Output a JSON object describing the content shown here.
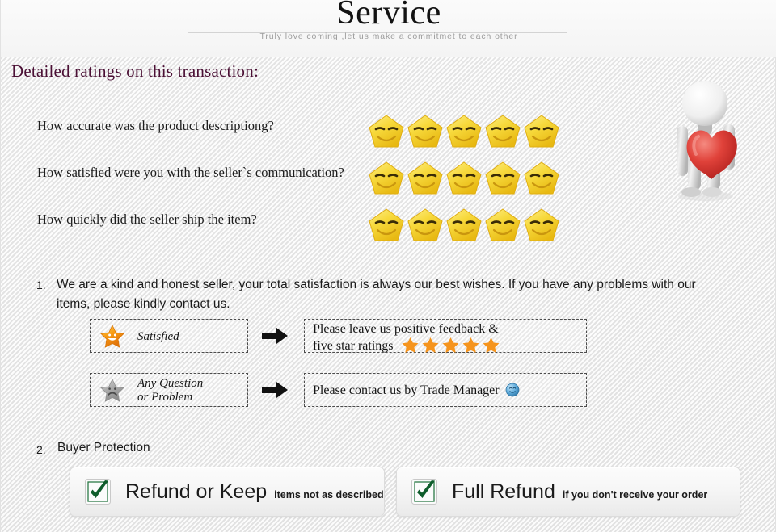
{
  "header": {
    "title": "Service",
    "subtitle": "Truly love coming ,let us make a commitmet to each other"
  },
  "section": {
    "heading": "Detailed ratings on this transaction:"
  },
  "ratings": {
    "stars_per_row": 5,
    "star_icon": "smiley-star-icon",
    "rows": [
      {
        "question": "How accurate was the product descriptiong?",
        "stars": 5
      },
      {
        "question": "How satisfied were you with the seller`s communication?",
        "stars": 5
      },
      {
        "question": "How quickly did the seller ship the item?",
        "stars": 5
      }
    ]
  },
  "mascot": {
    "icon": "3d-figure-holding-heart-icon"
  },
  "items": [
    {
      "number": "1.",
      "text": "We are a kind and honest seller, your total satisfaction is always our best wishes. If you have any problems with our items, please kindly contact us."
    },
    {
      "number": "2.",
      "text": "Buyer Protection"
    }
  ],
  "flows": [
    {
      "left_icon": "happy-star-icon",
      "left_label_line1": "Satisfied",
      "left_label_line2": "",
      "arrow_icon": "right-arrow-icon",
      "right_line1": "Please leave us positive feedback &",
      "right_line2": "five star ratings",
      "right_stars": 5,
      "right_star_icon": "orange-star-icon",
      "right_trailing_icon": ""
    },
    {
      "left_icon": "sad-star-icon",
      "left_label_line1": "Any Question",
      "left_label_line2": "or Problem",
      "arrow_icon": "right-arrow-icon",
      "right_line1": "Please contact us by Trade Manager",
      "right_line2": "",
      "right_stars": 0,
      "right_star_icon": "",
      "right_trailing_icon": "trade-manager-icon"
    }
  ],
  "protection": [
    {
      "check_icon": "green-checkmark-icon",
      "title": "Refund or Keep",
      "note": "items not as described"
    },
    {
      "check_icon": "green-checkmark-icon",
      "title": "Full Refund",
      "note": "if you don't receive your order"
    }
  ],
  "colors": {
    "heading": "#4b1035",
    "body_text": "#1b1b1b",
    "subtitle": "#9d9d9d",
    "star_yellow": "#f5d83b",
    "star_orange": "#f59415",
    "star_gray": "#a8a8a8",
    "heart_red": "#e03a33",
    "check_green": "#1a6b36",
    "background": "#f1f1f1"
  }
}
